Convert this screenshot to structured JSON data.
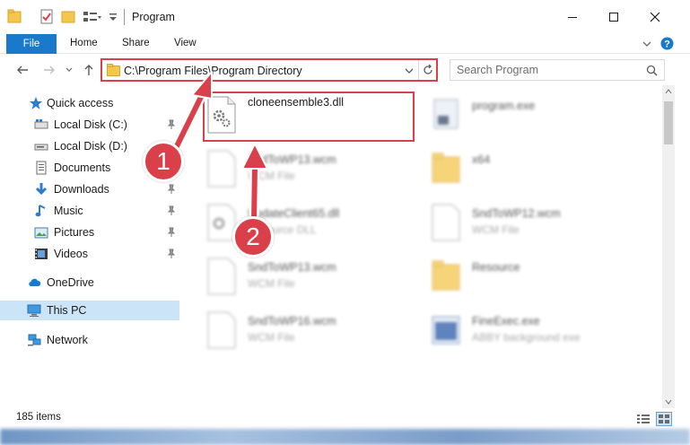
{
  "window": {
    "title": "Program"
  },
  "ribbon": {
    "tabs": [
      "File",
      "Home",
      "Share",
      "View"
    ]
  },
  "address": {
    "path": "C:\\Program Files\\Program Directory",
    "search_placeholder": "Search Program"
  },
  "nav": {
    "items": [
      {
        "label": "Quick access",
        "icon": "star-icon"
      },
      {
        "label": "Local Disk (C:)",
        "icon": "drive-icon"
      },
      {
        "label": "Local Disk (D:)",
        "icon": "drive-icon"
      },
      {
        "label": "Documents",
        "icon": "document-icon"
      },
      {
        "label": "Downloads",
        "icon": "download-icon"
      },
      {
        "label": "Music",
        "icon": "music-icon"
      },
      {
        "label": "Pictures",
        "icon": "pictures-icon"
      },
      {
        "label": "Videos",
        "icon": "videos-icon"
      },
      {
        "label": "OneDrive",
        "icon": "cloud-icon"
      },
      {
        "label": "This PC",
        "icon": "computer-icon"
      },
      {
        "label": "Network",
        "icon": "network-icon"
      }
    ]
  },
  "files": {
    "highlighted": {
      "name": "cloneensemble3.dll"
    },
    "left": [
      {
        "name": "SndToWP13.wcm",
        "type": "WCM File"
      },
      {
        "name": "UpdateClient65.dll",
        "type": "Resource DLL"
      },
      {
        "name": "SndToWP13.wcm",
        "type": "WCM File"
      },
      {
        "name": "SndToWP16.wcm",
        "type": "WCM File"
      }
    ],
    "right": [
      {
        "name": "program.exe",
        "type": ""
      },
      {
        "name": "x64",
        "type": ""
      },
      {
        "name": "SndToWP12.wcm",
        "type": "WCM File"
      },
      {
        "name": "Resource",
        "type": ""
      },
      {
        "name": "FineExec.exe",
        "type": "ABBY background exe"
      }
    ]
  },
  "status": {
    "count": "185 items"
  },
  "annotations": {
    "step1": "1",
    "step2": "2"
  },
  "colors": {
    "accent": "#1979ca",
    "annotation_red": "#d9404a",
    "selection": "#cce4f7"
  }
}
